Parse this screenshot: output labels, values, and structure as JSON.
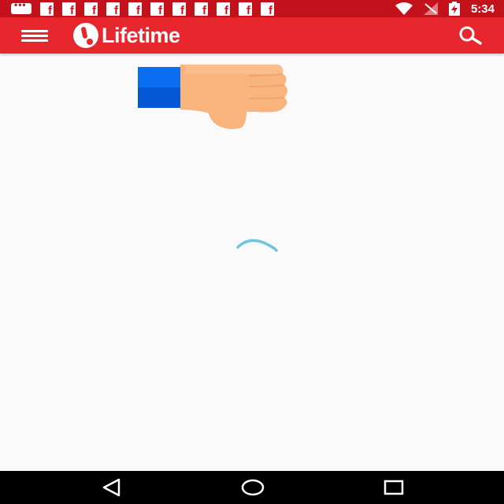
{
  "status_bar": {
    "time": "5:34",
    "notification_icons": [
      "message-icon",
      "facebook-icon",
      "facebook-icon",
      "facebook-icon",
      "facebook-icon",
      "facebook-icon",
      "facebook-icon",
      "facebook-icon",
      "facebook-icon",
      "facebook-icon",
      "facebook-icon",
      "facebook-icon"
    ],
    "status_icons": [
      "wifi-icon",
      "signal-off-icon",
      "battery-charging-icon"
    ]
  },
  "app_bar": {
    "logo_text": "Lifetime",
    "menu_icon": "hamburger-menu-icon",
    "search_icon": "search-icon",
    "color": "#e8262d"
  },
  "content": {
    "feedback_icon": "thumbs-down-icon",
    "loading_indicator": "spinner-icon"
  },
  "nav_bar": {
    "buttons": [
      "back-icon",
      "home-icon",
      "recent-apps-icon"
    ]
  }
}
